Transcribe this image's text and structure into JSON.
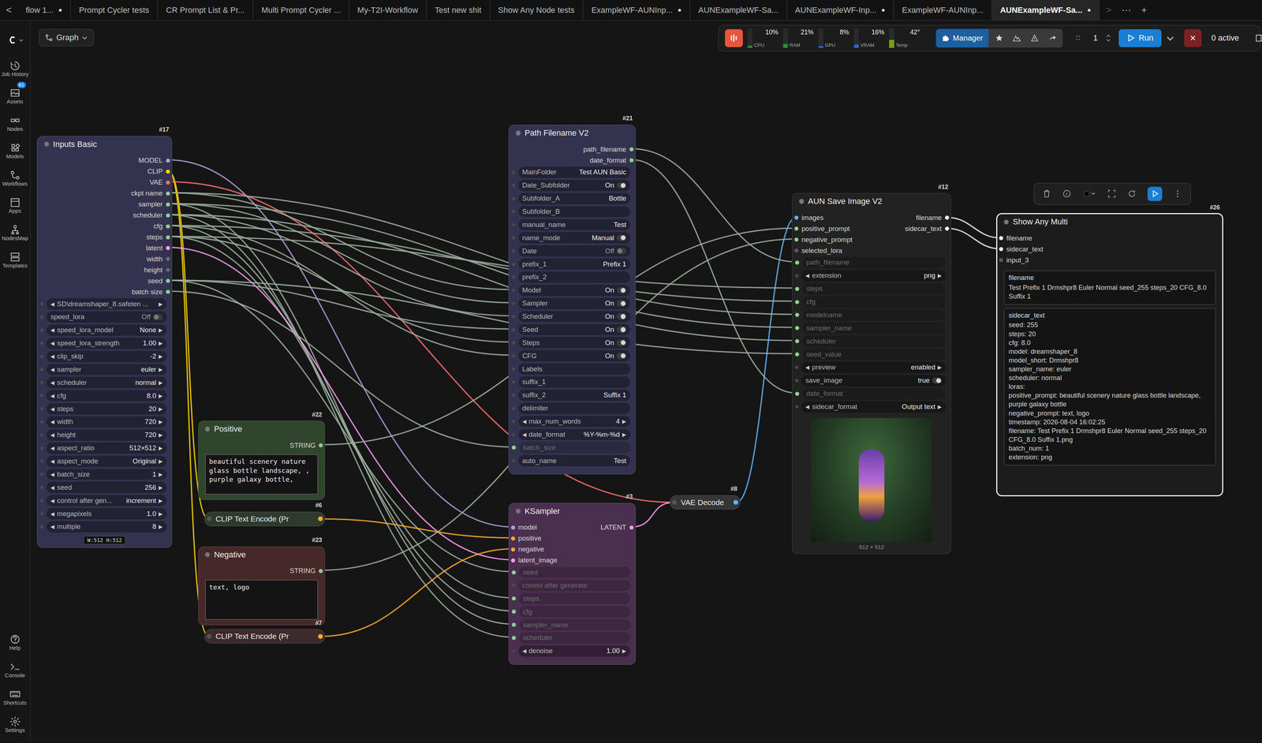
{
  "tabbar": {
    "back": "<",
    "scroll": ">",
    "more": "⋯",
    "add": "+",
    "modified_mark": "●",
    "tabs": [
      {
        "label": "flow 1...",
        "modified": true,
        "selected": false
      },
      {
        "label": "Prompt Cycler tests",
        "modified": false,
        "selected": false
      },
      {
        "label": "CR Prompt List & Pr...",
        "modified": false,
        "selected": false
      },
      {
        "label": "Multi Prompt Cycler ...",
        "modified": false,
        "selected": false
      },
      {
        "label": "My-T2I-Workflow",
        "modified": false,
        "selected": false
      },
      {
        "label": "Test new shit",
        "modified": false,
        "selected": false
      },
      {
        "label": "Show Any Node tests",
        "modified": false,
        "selected": false
      },
      {
        "label": "ExampleWF-AUNInp...",
        "modified": true,
        "selected": false
      },
      {
        "label": "AUNExampleWF-Sa...",
        "modified": false,
        "selected": false
      },
      {
        "label": "AUNExampleWF-Inp...",
        "modified": true,
        "selected": false
      },
      {
        "label": "ExampleWF-AUNInp...",
        "modified": false,
        "selected": false
      },
      {
        "label": "AUNExampleWF-Sa...",
        "modified": true,
        "selected": true
      }
    ]
  },
  "sidebar": {
    "items": [
      {
        "label": "Job History",
        "badge": ""
      },
      {
        "label": "Assets",
        "badge": "61"
      },
      {
        "label": "Nodes",
        "badge": ""
      },
      {
        "label": "Models",
        "badge": ""
      },
      {
        "label": "Workflows",
        "badge": ""
      },
      {
        "label": "Apps",
        "badge": ""
      },
      {
        "label": "NodesMap",
        "badge": ""
      },
      {
        "label": "Templates",
        "badge": ""
      }
    ],
    "bottom": [
      {
        "label": "Help"
      },
      {
        "label": "Console"
      },
      {
        "label": "Shortcuts"
      },
      {
        "label": "Settings"
      }
    ]
  },
  "graph_button": {
    "label": "Graph"
  },
  "toolbar": {
    "monitors": [
      {
        "label": "CPU",
        "reading": "10%",
        "level": 0.1,
        "color": "#2e8b3a"
      },
      {
        "label": "RAM",
        "reading": "21%",
        "level": 0.21,
        "color": "#2e8b3a"
      },
      {
        "label": "GPU",
        "reading": "8%",
        "level": 0.08,
        "color": "#1e6fd0"
      },
      {
        "label": "VRAM",
        "reading": "16%",
        "level": 0.16,
        "color": "#1e6fd0"
      },
      {
        "label": "Temp",
        "reading": "42°",
        "level": 0.42,
        "color": "#7a9a1e"
      }
    ],
    "manager": "Manager",
    "queue_count": "1",
    "run": "Run",
    "active": "0 active"
  },
  "nodes": [
    {
      "id": "#17",
      "title": "Inputs Basic",
      "color": "#33334f",
      "collapsed": false,
      "selected": false,
      "inputs": [],
      "outputs": [
        {
          "label": "MODEL",
          "color": "#b39ddb"
        },
        {
          "label": "CLIP",
          "color": "#ffd500"
        },
        {
          "label": "VAE",
          "color": "#ff6e6e"
        },
        {
          "label": "ckpt name",
          "color": "#8fd18f"
        },
        {
          "label": "sampler",
          "color": "#8fd18f"
        },
        {
          "label": "scheduler",
          "color": "#8fd18f"
        },
        {
          "label": "cfg",
          "color": "#8fd18f"
        },
        {
          "label": "steps",
          "color": "#8fd18f"
        },
        {
          "label": "latent",
          "color": "#ff9cf9"
        },
        {
          "label": "width",
          "color": "#6a6a6a"
        },
        {
          "label": "height",
          "color": "#6a6a6a"
        },
        {
          "label": "seed",
          "color": "#8fd18f"
        },
        {
          "label": "batch size",
          "color": "#8fd18f"
        }
      ],
      "widgets": [
        {
          "kind": "combo",
          "label": "SD\\dreamshaper_8.safeten ...",
          "value": ""
        },
        {
          "kind": "toggle",
          "label": "speed_lora",
          "value": "Off",
          "on": false
        },
        {
          "kind": "combo",
          "label": "speed_lora_model",
          "value": "None"
        },
        {
          "kind": "combo",
          "label": "speed_lora_strength",
          "value": "1.00"
        },
        {
          "kind": "combo",
          "label": "clip_skip",
          "value": "-2"
        },
        {
          "kind": "combo",
          "label": "sampler",
          "value": "euler"
        },
        {
          "kind": "combo",
          "label": "scheduler",
          "value": "normal"
        },
        {
          "kind": "combo",
          "label": "cfg",
          "value": "8.0"
        },
        {
          "kind": "combo",
          "label": "steps",
          "value": "20"
        },
        {
          "kind": "combo",
          "label": "width",
          "value": "720"
        },
        {
          "kind": "combo",
          "label": "height",
          "value": "720"
        },
        {
          "kind": "combo",
          "label": "aspect_ratio",
          "value": "512×512"
        },
        {
          "kind": "combo",
          "label": "aspect_mode",
          "value": "Original"
        },
        {
          "kind": "combo",
          "label": "batch_size",
          "value": "1"
        },
        {
          "kind": "combo",
          "label": "seed",
          "value": "256"
        },
        {
          "kind": "combo",
          "label": "control after gen...",
          "value": "increment"
        },
        {
          "kind": "combo",
          "label": "megapixels",
          "value": "1.0"
        },
        {
          "kind": "combo",
          "label": "multiple",
          "value": "8"
        }
      ],
      "footer": "W:512 H:512"
    },
    {
      "id": "#22",
      "title": "Positive",
      "color": "#2f452c",
      "collapsed": false,
      "selected": false,
      "inputs": [],
      "outputs": [
        {
          "label": "STRING",
          "color": "#8fd18f"
        }
      ],
      "widgets": [],
      "textarea": "beautiful scenery nature glass bottle landscape, , purple galaxy bottle,"
    },
    {
      "id": "#6",
      "title": "CLIP Text Encode (Pr",
      "color": "#2e3a2c",
      "collapsed": true,
      "selected": false,
      "inputs": [
        {
          "label": "",
          "color": "#555555"
        }
      ],
      "outputs": [
        {
          "label": "",
          "color": "#ffa931"
        }
      ],
      "widgets": []
    },
    {
      "id": "#23",
      "title": "Negative",
      "color": "#472828",
      "collapsed": false,
      "selected": false,
      "inputs": [],
      "outputs": [
        {
          "label": "STRING",
          "color": "#8fd18f"
        }
      ],
      "widgets": [],
      "textarea": "text, logo"
    },
    {
      "id": "#7",
      "title": "CLIP Text Encode (Pr",
      "color": "#3d2a2a",
      "collapsed": true,
      "selected": false,
      "inputs": [
        {
          "label": "",
          "color": "#555555"
        }
      ],
      "outputs": [
        {
          "label": "",
          "color": "#ffa931"
        }
      ],
      "widgets": []
    },
    {
      "id": "#21",
      "title": "Path Filename V2",
      "color": "#33334f",
      "collapsed": false,
      "selected": false,
      "inputs": [],
      "outputs": [
        {
          "label": "path_filename",
          "color": "#8fd18f"
        },
        {
          "label": "date_format",
          "color": "#8fd18f"
        }
      ],
      "widgets": [
        {
          "kind": "text",
          "label": "MainFolder",
          "value": "Test AUN Basic"
        },
        {
          "kind": "toggle",
          "label": "Date_Subfolder",
          "value": "On",
          "on": true
        },
        {
          "kind": "text",
          "label": "Subfolder_A",
          "value": "Bottle"
        },
        {
          "kind": "text",
          "label": "Subfolder_B",
          "value": ""
        },
        {
          "kind": "text",
          "label": "manual_name",
          "value": "Test"
        },
        {
          "kind": "toggle",
          "label": "name_mode",
          "value": "Manual",
          "on": true
        },
        {
          "kind": "toggle",
          "label": "Date",
          "value": "Off",
          "on": false
        },
        {
          "kind": "text",
          "label": "prefix_1",
          "value": "Prefix 1"
        },
        {
          "kind": "text",
          "label": "prefix_2",
          "value": ""
        },
        {
          "kind": "toggle",
          "label": "Model",
          "value": "On",
          "on": true
        },
        {
          "kind": "toggle",
          "label": "Sampler",
          "value": "On",
          "on": true
        },
        {
          "kind": "toggle",
          "label": "Scheduler",
          "value": "On",
          "on": true
        },
        {
          "kind": "toggle",
          "label": "Seed",
          "value": "On",
          "on": true
        },
        {
          "kind": "toggle",
          "label": "Steps",
          "value": "On",
          "on": true
        },
        {
          "kind": "toggle",
          "label": "CFG",
          "value": "On",
          "on": true
        },
        {
          "kind": "text",
          "label": "Labels",
          "value": ""
        },
        {
          "kind": "text",
          "label": "suffix_1",
          "value": ""
        },
        {
          "kind": "text",
          "label": "suffix_2",
          "value": "Suffix 1"
        },
        {
          "kind": "text",
          "label": "delimiter",
          "value": ""
        },
        {
          "kind": "combo",
          "label": "max_num_words",
          "value": "4"
        },
        {
          "kind": "combo",
          "label": "date_format",
          "value": "%Y-%m-%d"
        },
        {
          "kind": "socket",
          "label": "batch_size",
          "value": "",
          "connected": true
        },
        {
          "kind": "text",
          "label": "auto_name",
          "value": "Test"
        }
      ]
    },
    {
      "id": "#3",
      "title": "KSampler",
      "color": "#4a2f4f",
      "collapsed": false,
      "selected": false,
      "inputs": [
        {
          "label": "model",
          "color": "#b39ddb"
        },
        {
          "label": "positive",
          "color": "#ffa931"
        },
        {
          "label": "negative",
          "color": "#ffa931"
        },
        {
          "label": "latent_image",
          "color": "#ff9cf9"
        }
      ],
      "outputs": [
        {
          "label": "LATENT",
          "color": "#ff9cf9"
        }
      ],
      "widgets": [
        {
          "kind": "socket",
          "label": "seed",
          "value": "",
          "connected": true
        },
        {
          "kind": "socket",
          "label": "control after generate",
          "value": "",
          "connected": false
        },
        {
          "kind": "socket",
          "label": "steps",
          "value": "",
          "connected": true
        },
        {
          "kind": "socket",
          "label": "cfg",
          "value": "",
          "connected": true
        },
        {
          "kind": "socket",
          "label": "sampler_name",
          "value": "",
          "connected": true
        },
        {
          "kind": "socket",
          "label": "scheduler",
          "value": "",
          "connected": true
        },
        {
          "kind": "combo",
          "label": "denoise",
          "value": "1.00"
        }
      ]
    },
    {
      "id": "#8",
      "title": "VAE Decode",
      "color": "#353535",
      "collapsed": true,
      "selected": false,
      "inputs": [
        {
          "label": "",
          "color": "#555555"
        }
      ],
      "outputs": [
        {
          "label": "",
          "color": "#64b5f6"
        }
      ],
      "widgets": []
    },
    {
      "id": "#12",
      "title": "AUN Save Image V2",
      "color": "#222222",
      "collapsed": false,
      "selected": false,
      "inputs": [
        {
          "label": "images",
          "color": "#64b5f6"
        },
        {
          "label": "positive_prompt",
          "color": "#8fd18f"
        },
        {
          "label": "negative_prompt",
          "color": "#8fd18f"
        },
        {
          "label": "selected_lora",
          "color": "#5a5a5a"
        }
      ],
      "outputs": [
        {
          "label": "filename",
          "color": "#f2f2f2"
        },
        {
          "label": "sidecar_text",
          "color": "#f2f2f2"
        }
      ],
      "widgets": [
        {
          "kind": "socket",
          "label": "path_filename",
          "value": "",
          "connected": true
        },
        {
          "kind": "combo",
          "label": "extension",
          "value": "png"
        },
        {
          "kind": "socket",
          "label": "steps",
          "value": "",
          "connected": true
        },
        {
          "kind": "socket",
          "label": "cfg",
          "value": "",
          "connected": true
        },
        {
          "kind": "socket",
          "label": "modelname",
          "value": "",
          "connected": true
        },
        {
          "kind": "socket",
          "label": "sampler_name",
          "value": "",
          "connected": true
        },
        {
          "kind": "socket",
          "label": "scheduler",
          "value": "",
          "connected": true
        },
        {
          "kind": "socket",
          "label": "seed_value",
          "value": "",
          "connected": true
        },
        {
          "kind": "combo",
          "label": "preview",
          "value": "enabled"
        },
        {
          "kind": "toggle",
          "label": "save_image",
          "value": "true",
          "on": true
        },
        {
          "kind": "socket",
          "label": "date_format",
          "value": "",
          "connected": true
        },
        {
          "kind": "combo",
          "label": "sidecar_format",
          "value": "Output text"
        }
      ],
      "preview": {
        "caption": "512 × 512"
      }
    },
    {
      "id": "#26",
      "title": "Show Any Multi",
      "color": "#1c1c1c",
      "collapsed": false,
      "selected": true,
      "inputs": [
        {
          "label": "filename",
          "color": "#f2f2f2"
        },
        {
          "label": "sidecar_text",
          "color": "#f2f2f2"
        },
        {
          "label": "input_3",
          "color": "#5a5a5a"
        }
      ],
      "outputs": [],
      "widgets": [],
      "sections": [
        {
          "title": "filename",
          "lines": [
            "Test Prefix 1 Drmshpr8 Euler Normal seed_255 steps_20 CFG_8.0 Suffix 1"
          ]
        },
        {
          "title": "sidecar_text",
          "lines": [
            "seed: 255",
            "steps: 20",
            "cfg: 8.0",
            "model: dreamshaper_8",
            "model_short: Drmshpr8",
            "sampler_name: euler",
            "scheduler: normal",
            "loras:",
            "positive_prompt: beautiful scenery nature glass bottle landscape, purple galaxy bottle",
            "negative_prompt: text, logo",
            "timestamp: 2026-08-04 16:02:25",
            "filename: Test Prefix 1 Drmshpr8 Euler Normal seed_255 steps_20 CFG_8.0 Suffix 1.png",
            "batch_num: 1",
            "extension: png"
          ]
        }
      ]
    }
  ],
  "glyphs": {
    "left": "◀",
    "right": "▶"
  }
}
